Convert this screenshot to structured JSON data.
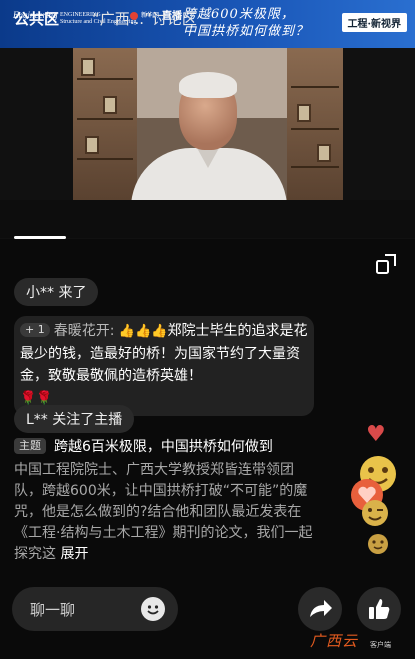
{
  "banner": {
    "logo_engineering": "Engineering",
    "logo_struct_line1": "ENGINEERING",
    "logo_struct_line2": "Structure and Civil Engineering",
    "logo_xhs": "新华网",
    "logo_live": "直播",
    "title_line1": "跨越600米极限，",
    "title_line2": "中国拱桥如何做到？",
    "tag": "工程·新视界"
  },
  "tabs": {
    "public": "公共区",
    "discussion": "“广西...”讨论区"
  },
  "chat": {
    "join_text": "小** 来了",
    "message": {
      "badge": "+ 1",
      "user": "春暖花开:",
      "emojis": "👍👍👍",
      "text": "郑院士毕生的追求是花最少的钱，造最好的桥！为国家节约了大量资金，致敬最敬佩的造桥英雄！",
      "tail_emojis": "🌹🌹"
    },
    "follow_text": "L** 关注了主播",
    "topic": {
      "badge": "主题",
      "title": "跨越6百米极限，中国拱桥如何做到",
      "body": "中国工程院院士、广西大学教授郑皆连带领团队，跨越600米，让中国拱桥打破“不可能”的魔咒，他是怎么做到的?结合他和团队最近发表在《工程·结构与土木工程》期刊的论文，我们一起探究这",
      "expand": "展开"
    }
  },
  "bottom": {
    "input_placeholder": "聊一聊"
  },
  "watermark": {
    "text": "广西云",
    "small": "客户端"
  },
  "icons": {
    "collapse": "screen-rotate-icon",
    "emoji": "smiley-icon",
    "share": "share-arrow-icon",
    "like": "thumbs-up-icon",
    "heart": "heart-icon"
  },
  "colors": {
    "banner": "#1a57b8",
    "background": "#0a0a0a",
    "heart": "#d94a4a",
    "watermark": "#e35b1f"
  }
}
